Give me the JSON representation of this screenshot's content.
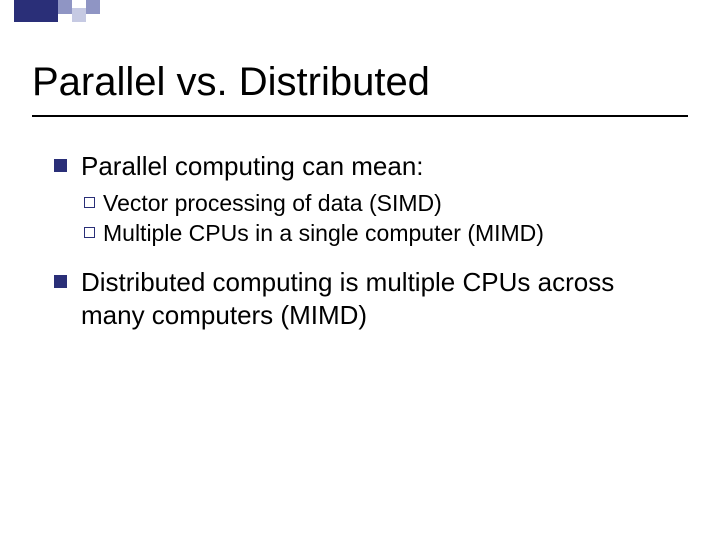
{
  "accent_color": "#2a2f78",
  "decor_squares": [
    {
      "size": 22,
      "bg": "#2a2f78",
      "opacity": 1.0
    },
    {
      "size": 22,
      "bg": "#2a2f78",
      "opacity": 1.0
    },
    {
      "size": 14,
      "bg": "#8f95c4",
      "opacity": 1.0
    },
    {
      "size": 14,
      "bg": "#c6cae3",
      "opacity": 1.0
    },
    {
      "size": 14,
      "bg": "#8f95c4",
      "opacity": 1.0
    }
  ],
  "title": "Parallel vs. Distributed",
  "bullets": [
    {
      "text": "Parallel computing can mean:",
      "sub": [
        "Vector processing of data (SIMD)",
        "Multiple CPUs in a single computer (MIMD)"
      ]
    },
    {
      "text": "Distributed computing is multiple CPUs across many computers (MIMD)",
      "sub": []
    }
  ]
}
